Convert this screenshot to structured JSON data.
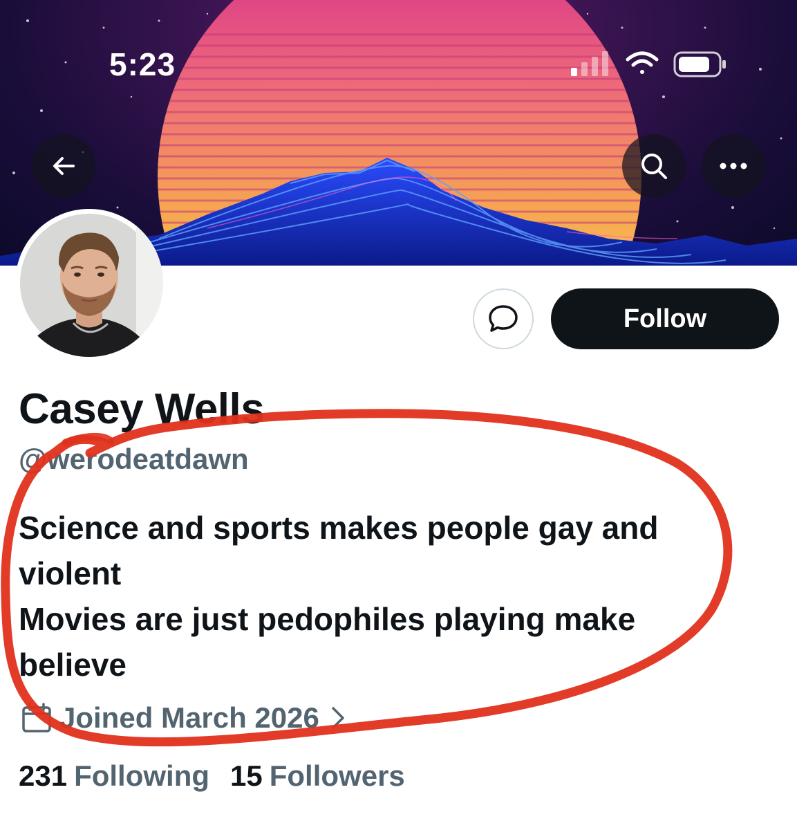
{
  "status_bar": {
    "time": "5:23",
    "icons": [
      "cellular-signal-icon",
      "wifi-icon",
      "battery-icon"
    ]
  },
  "header": {
    "back_icon": "arrow-left-icon",
    "search_icon": "search-icon",
    "more_icon": "more-horizontal-icon"
  },
  "profile": {
    "display_name": "Casey Wells",
    "handle": "@werodeatdawn",
    "bio_lines": [
      "Science and sports makes people gay and",
      "violent",
      "Movies are just pedophiles playing make",
      "believe"
    ],
    "joined": "Joined March 2026",
    "following_count": "231",
    "following_label": "Following",
    "followers_count": "15",
    "followers_label": "Followers"
  },
  "actions": {
    "follow_label": "Follow",
    "message_icon": "message-bubble-icon"
  },
  "colors": {
    "primary_text": "#0f1419",
    "secondary_text": "#536471",
    "follow_button": "#0f1419",
    "annotation_red": "#e0321c"
  }
}
